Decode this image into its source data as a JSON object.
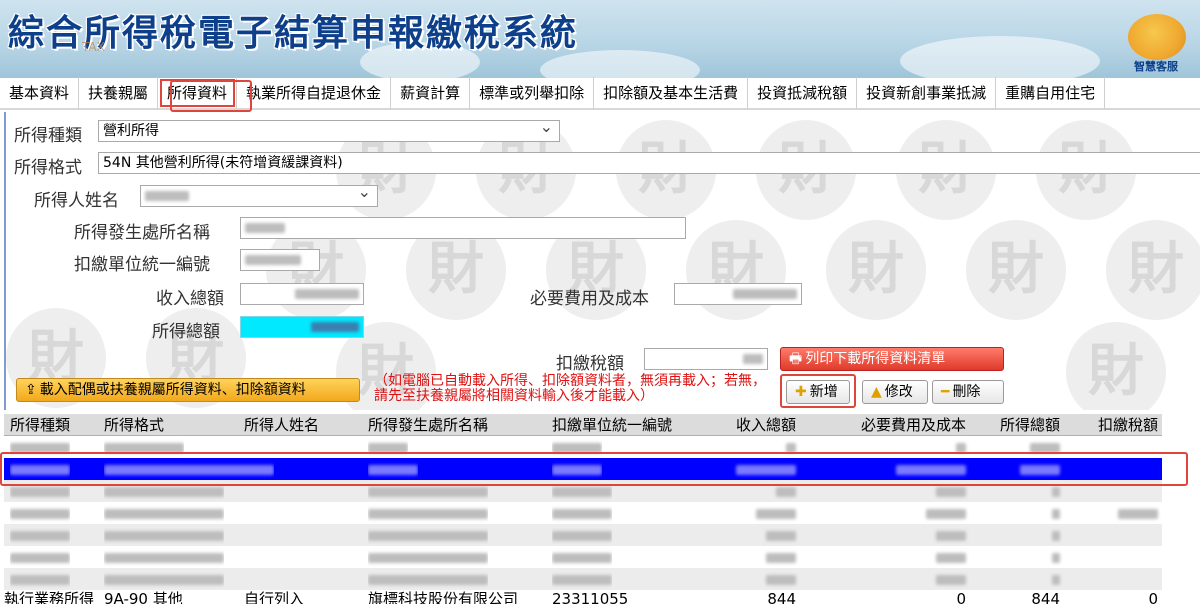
{
  "header": {
    "title": "綜合所得稅電子結算申報繳稅系統",
    "tax_mark": "TAX",
    "mascot_label": "智慧客服"
  },
  "nav": {
    "items": [
      {
        "label": "基本資料"
      },
      {
        "label": "扶養親屬"
      },
      {
        "label": "所得資料"
      },
      {
        "label": "執業所得自提退休金"
      },
      {
        "label": "薪資計算"
      },
      {
        "label": "標準或列舉扣除"
      },
      {
        "label": "扣除額及基本生活費"
      },
      {
        "label": "投資抵減稅額"
      },
      {
        "label": "投資新創事業抵減"
      },
      {
        "label": "重購自用住宅"
      }
    ],
    "active_index": 2
  },
  "form": {
    "income_type_label": "所得種類",
    "income_type_value": "營利所得",
    "income_format_label": "所得格式",
    "income_format_value": "54N 其他營利所得(未符增資緩課資料)",
    "earner_name_label": "所得人姓名",
    "payer_name_label": "所得發生處所名稱",
    "payer_id_label": "扣繳單位統一編號",
    "gross_income_label": "收入總額",
    "expenses_label": "必要費用及成本",
    "total_income_label": "所得總額",
    "withholding_label": "扣繳稅額"
  },
  "buttons": {
    "print": "列印下載所得資料清單",
    "load": "載入配偶或扶養親屬所得資料、扣除額資料",
    "add": "新增",
    "edit": "修改",
    "delete": "刪除"
  },
  "note": "（如電腦已自動載入所得、扣除額資料者，無須再載入；若無，請先至扶養親屬將相關資料輸入後才能載入）",
  "table": {
    "headers": [
      "所得種類",
      "所得格式",
      "所得人姓名",
      "所得發生處所名稱",
      "扣繳單位統一編號",
      "收入總額",
      "必要費用及成本",
      "所得總額",
      "扣繳稅額"
    ],
    "last_row": [
      "執行業務所得",
      "9A-90 其他",
      "自行列入",
      "旗標科技股份有限公司",
      "23311055",
      "844",
      "0",
      "844",
      "0"
    ]
  }
}
